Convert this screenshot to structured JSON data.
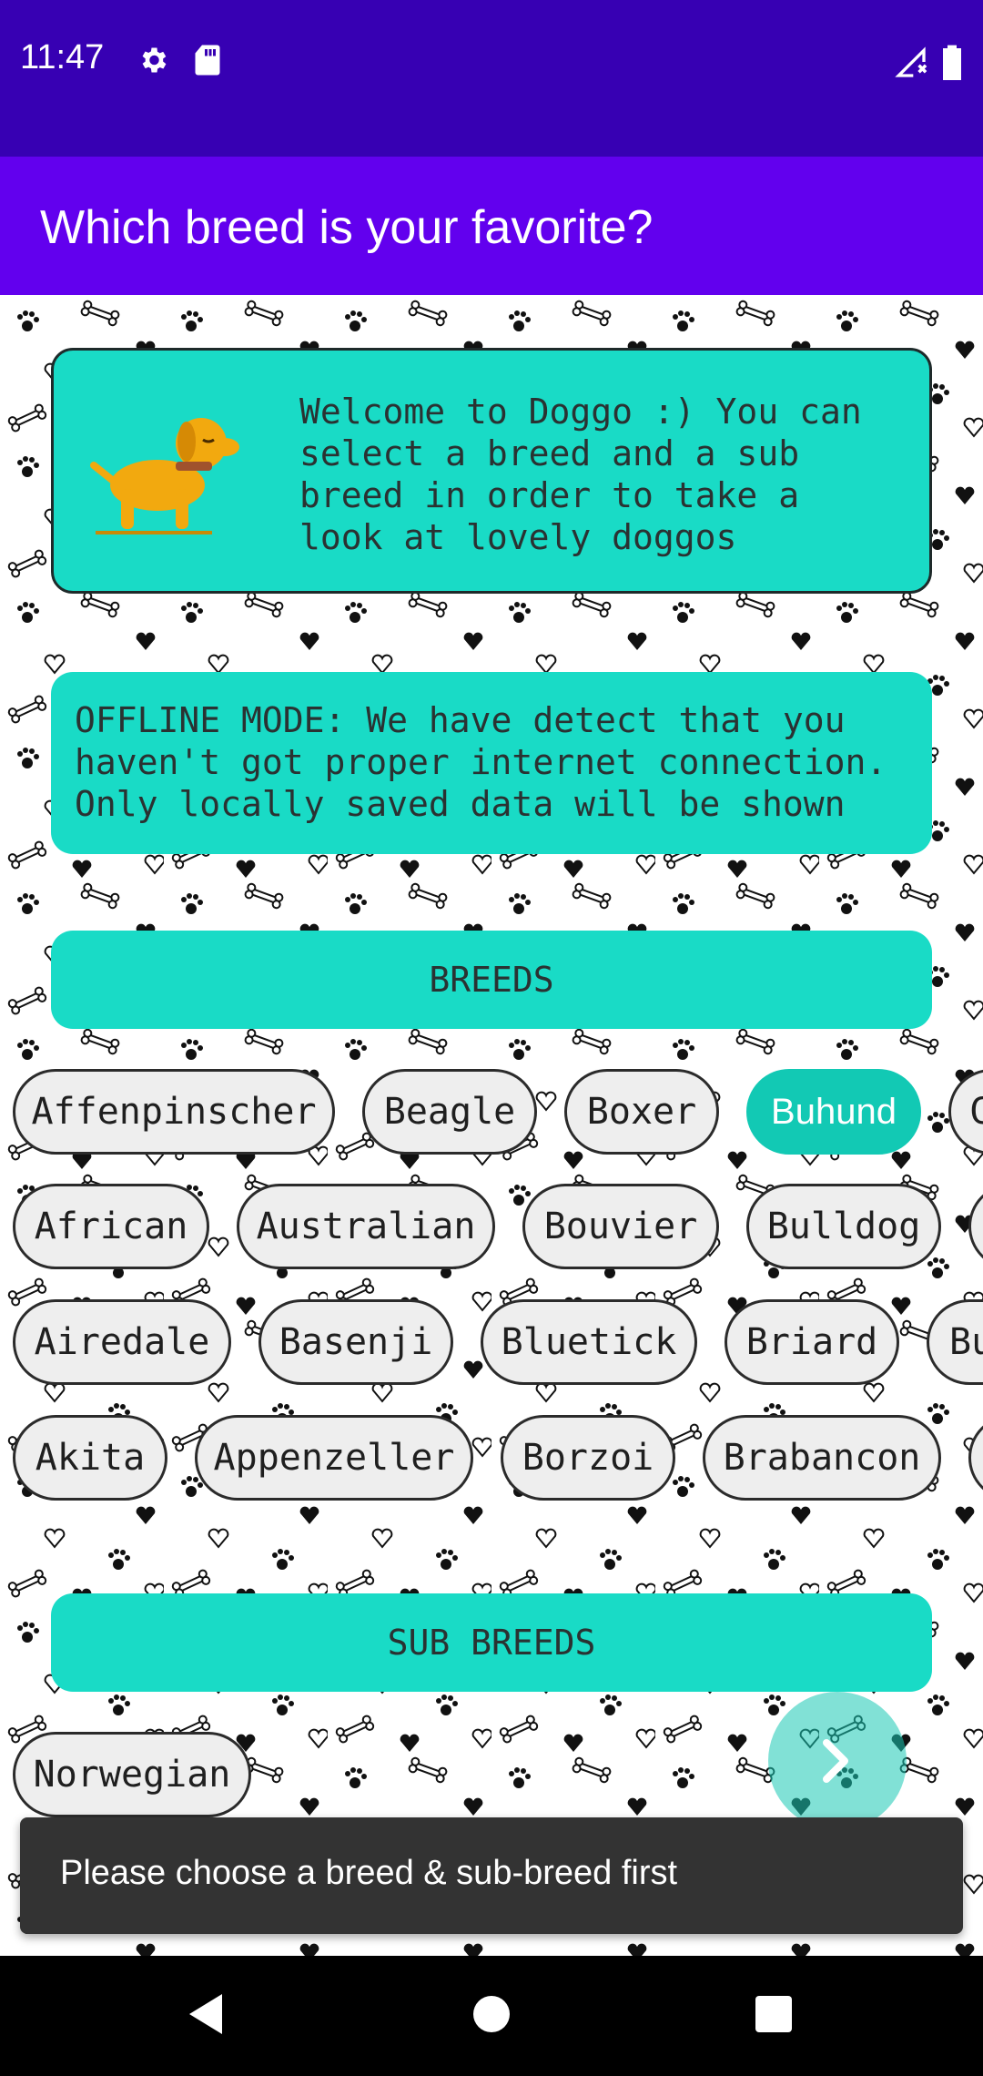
{
  "status_bar": {
    "time": "11:47",
    "icons": [
      "settings-gear-icon",
      "sd-card-icon",
      "no-signal-icon",
      "battery-icon"
    ]
  },
  "app_bar": {
    "title": "Which breed is your favorite?"
  },
  "welcome_card": {
    "text": "Welcome to Doggo :) You can\nselect a breed and a sub\nbreed in order to take a\nlook at lovely doggos",
    "icon": "dog-icon"
  },
  "offline_card": {
    "text": "OFFLINE MODE: We have detect that you\nhaven't got proper internet connection.\nOnly locally saved data will be shown"
  },
  "breeds": {
    "header": "BREEDS",
    "rows": [
      [
        "Affenpinscher",
        "Beagle",
        "Boxer",
        "Buhund",
        "C"
      ],
      [
        "African",
        "Australian",
        "Bouvier",
        "Bulldog",
        ""
      ],
      [
        "Airedale",
        "Basenji",
        "Bluetick",
        "Briard",
        "Bu"
      ],
      [
        "Akita",
        "Appenzeller",
        "Borzoi",
        "Brabancon",
        ""
      ]
    ],
    "selected": "Buhund"
  },
  "sub_breeds": {
    "header": "SUB BREEDS",
    "items": [
      "Norwegian"
    ]
  },
  "fab": {
    "icon": "chevron-right-icon"
  },
  "snackbar": {
    "message": "Please choose a breed & sub-breed first"
  },
  "colors": {
    "status_bar": "#3700b3",
    "app_bar": "#6200ee",
    "accent": "#19dbc6",
    "selected_chip": "#12c9b4"
  }
}
